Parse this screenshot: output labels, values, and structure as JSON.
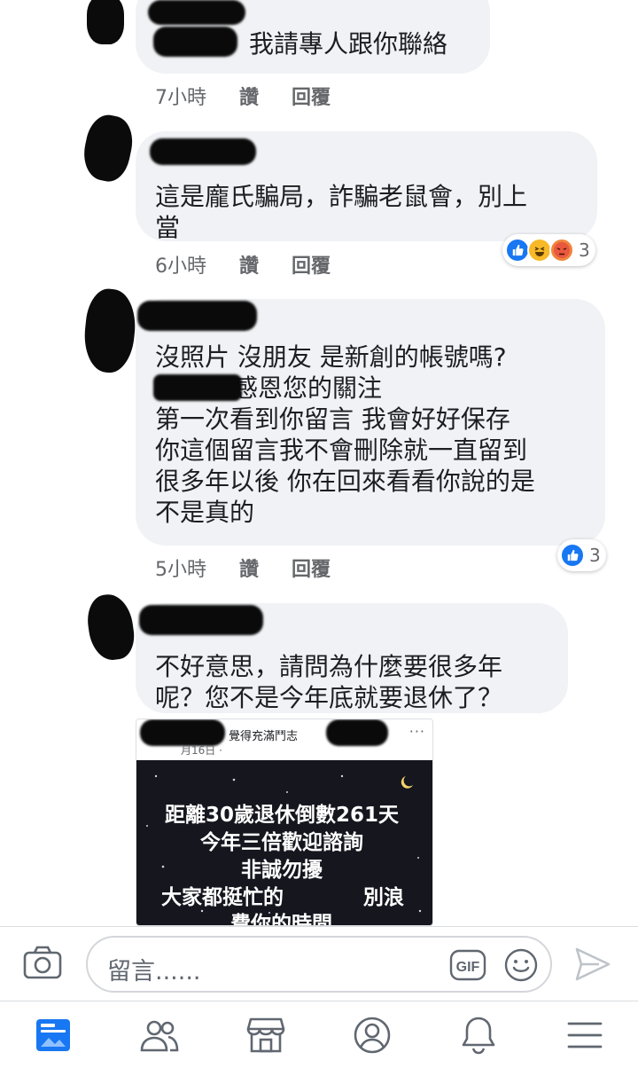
{
  "comments": [
    {
      "lines": [
        "我請專人跟你聯絡"
      ],
      "time": "7小時",
      "like": "讚",
      "reply": "回覆"
    },
    {
      "lines": [
        "這是龐氏騙局，詐騙老鼠會，別上",
        "當"
      ],
      "time": "6小時",
      "like": "讚",
      "reply": "回覆",
      "reaction_icons": [
        "like-icon",
        "haha-icon",
        "angry-icon"
      ],
      "reaction_count": "3"
    },
    {
      "lines": [
        "沒照片 沒朋友 是新創的帳號嗎?",
        "感恩您的關注",
        "第一次看到你留言 我會好好保存",
        "你這個留言我不會刪除就一直留到",
        "很多年以後 你在回來看看你說的是",
        "不是真的"
      ],
      "time": "5小時",
      "like": "讚",
      "reply": "回覆",
      "reaction_icons": [
        "like-icon"
      ],
      "reaction_count": "3"
    },
    {
      "lines": [
        "不好意思，請問為什麼要很多年",
        "呢？您不是今年底就要退休了？"
      ]
    }
  ],
  "shared_post": {
    "title": "覺得充滿鬥志",
    "date": "月16日 · ",
    "more": "···",
    "image_text": [
      "距離30歲退休倒數261天",
      "今年三倍歡迎諮詢",
      "非誠勿擾",
      "大家都挺忙的",
      "別浪",
      "費你的時間"
    ]
  },
  "composer": {
    "placeholder": "留言......",
    "gif_label": "GIF"
  },
  "colors": {
    "bubble": "#f0f2f5",
    "like_blue": "#1877f2",
    "meta_gray": "#65676b",
    "active_tab": "#1877f2"
  },
  "tabs": [
    "news-feed-icon",
    "friends-icon",
    "marketplace-icon",
    "profile-icon",
    "notifications-icon",
    "menu-icon"
  ]
}
